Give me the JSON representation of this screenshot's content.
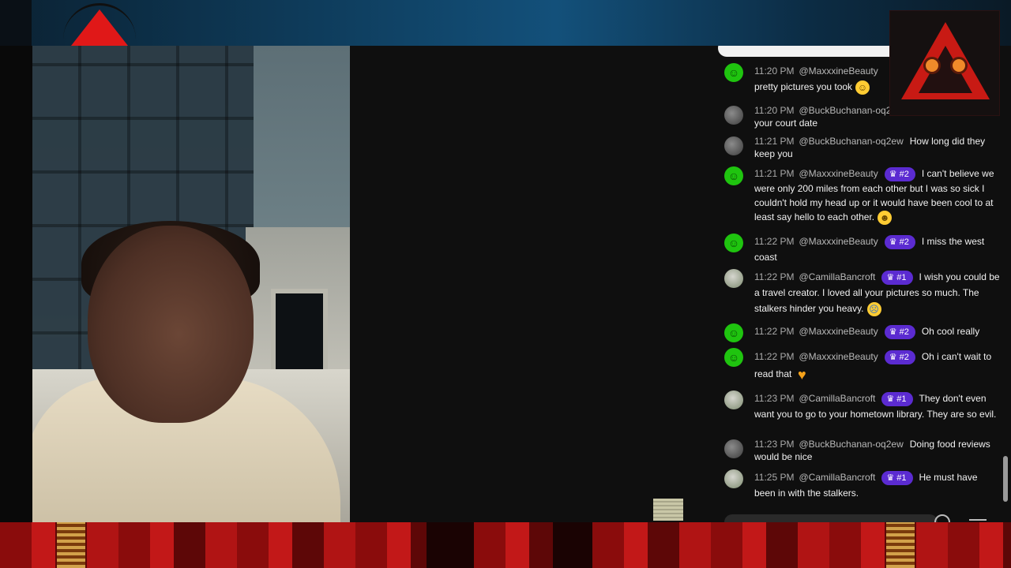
{
  "chat": {
    "messages": [
      {
        "time": "11:20 PM",
        "author": "@MaxxxineBeauty",
        "text": "pretty pictures you took",
        "emoji": "smiling-face-with-halo"
      },
      {
        "time": "11:20 PM",
        "author": "@BuckBuchanan-oq2",
        "text": "your court date"
      },
      {
        "time": "11:21 PM",
        "author": "@BuckBuchanan-oq2ew",
        "text": "How long did they keep you"
      },
      {
        "time": "11:21 PM",
        "author": "@MaxxxineBeauty",
        "badge": "#2",
        "text": "I can't believe we were only 200 miles from each other but I was so sick I couldn't hold my head up or it would have been cool to at least say hello to each other.",
        "emoji": "hugging-face"
      },
      {
        "time": "11:22 PM",
        "author": "@MaxxxineBeauty",
        "badge": "#2",
        "text": "I miss the west coast"
      },
      {
        "time": "11:22 PM",
        "author": "@CamillaBancroft",
        "badge": "#1",
        "text": "I wish you could be a travel creator. I loved all your pictures so much. The stalkers hinder you heavy.",
        "emoji": "loudly-crying-face"
      },
      {
        "time": "11:22 PM",
        "author": "@MaxxxineBeauty",
        "badge": "#2",
        "text": "Oh cool really"
      },
      {
        "time": "11:22 PM",
        "author": "@MaxxxineBeauty",
        "badge": "#2",
        "text": "Oh i can't wait to read that",
        "emoji": "orange-heart"
      },
      {
        "time": "11:23 PM",
        "author": "@CamillaBancroft",
        "badge": "#1",
        "text": "They don't even want you to go to your hometown library. They are so evil."
      },
      {
        "time": "11:23 PM",
        "author": "@BuckBuchanan-oq2ew",
        "text": "Doing food reviews would be nice"
      },
      {
        "time": "11:25 PM",
        "author": "@CamillaBancroft",
        "badge": "#1",
        "text": "He must have been in with the stalkers."
      }
    ]
  },
  "icons": {
    "crown": "crown-icon",
    "send": "send-icon",
    "menu": "menu-icon"
  },
  "colors": {
    "badge": "#5b2bd1",
    "chat_bg": "#0f0f0f",
    "banner_red": "#c21818"
  }
}
